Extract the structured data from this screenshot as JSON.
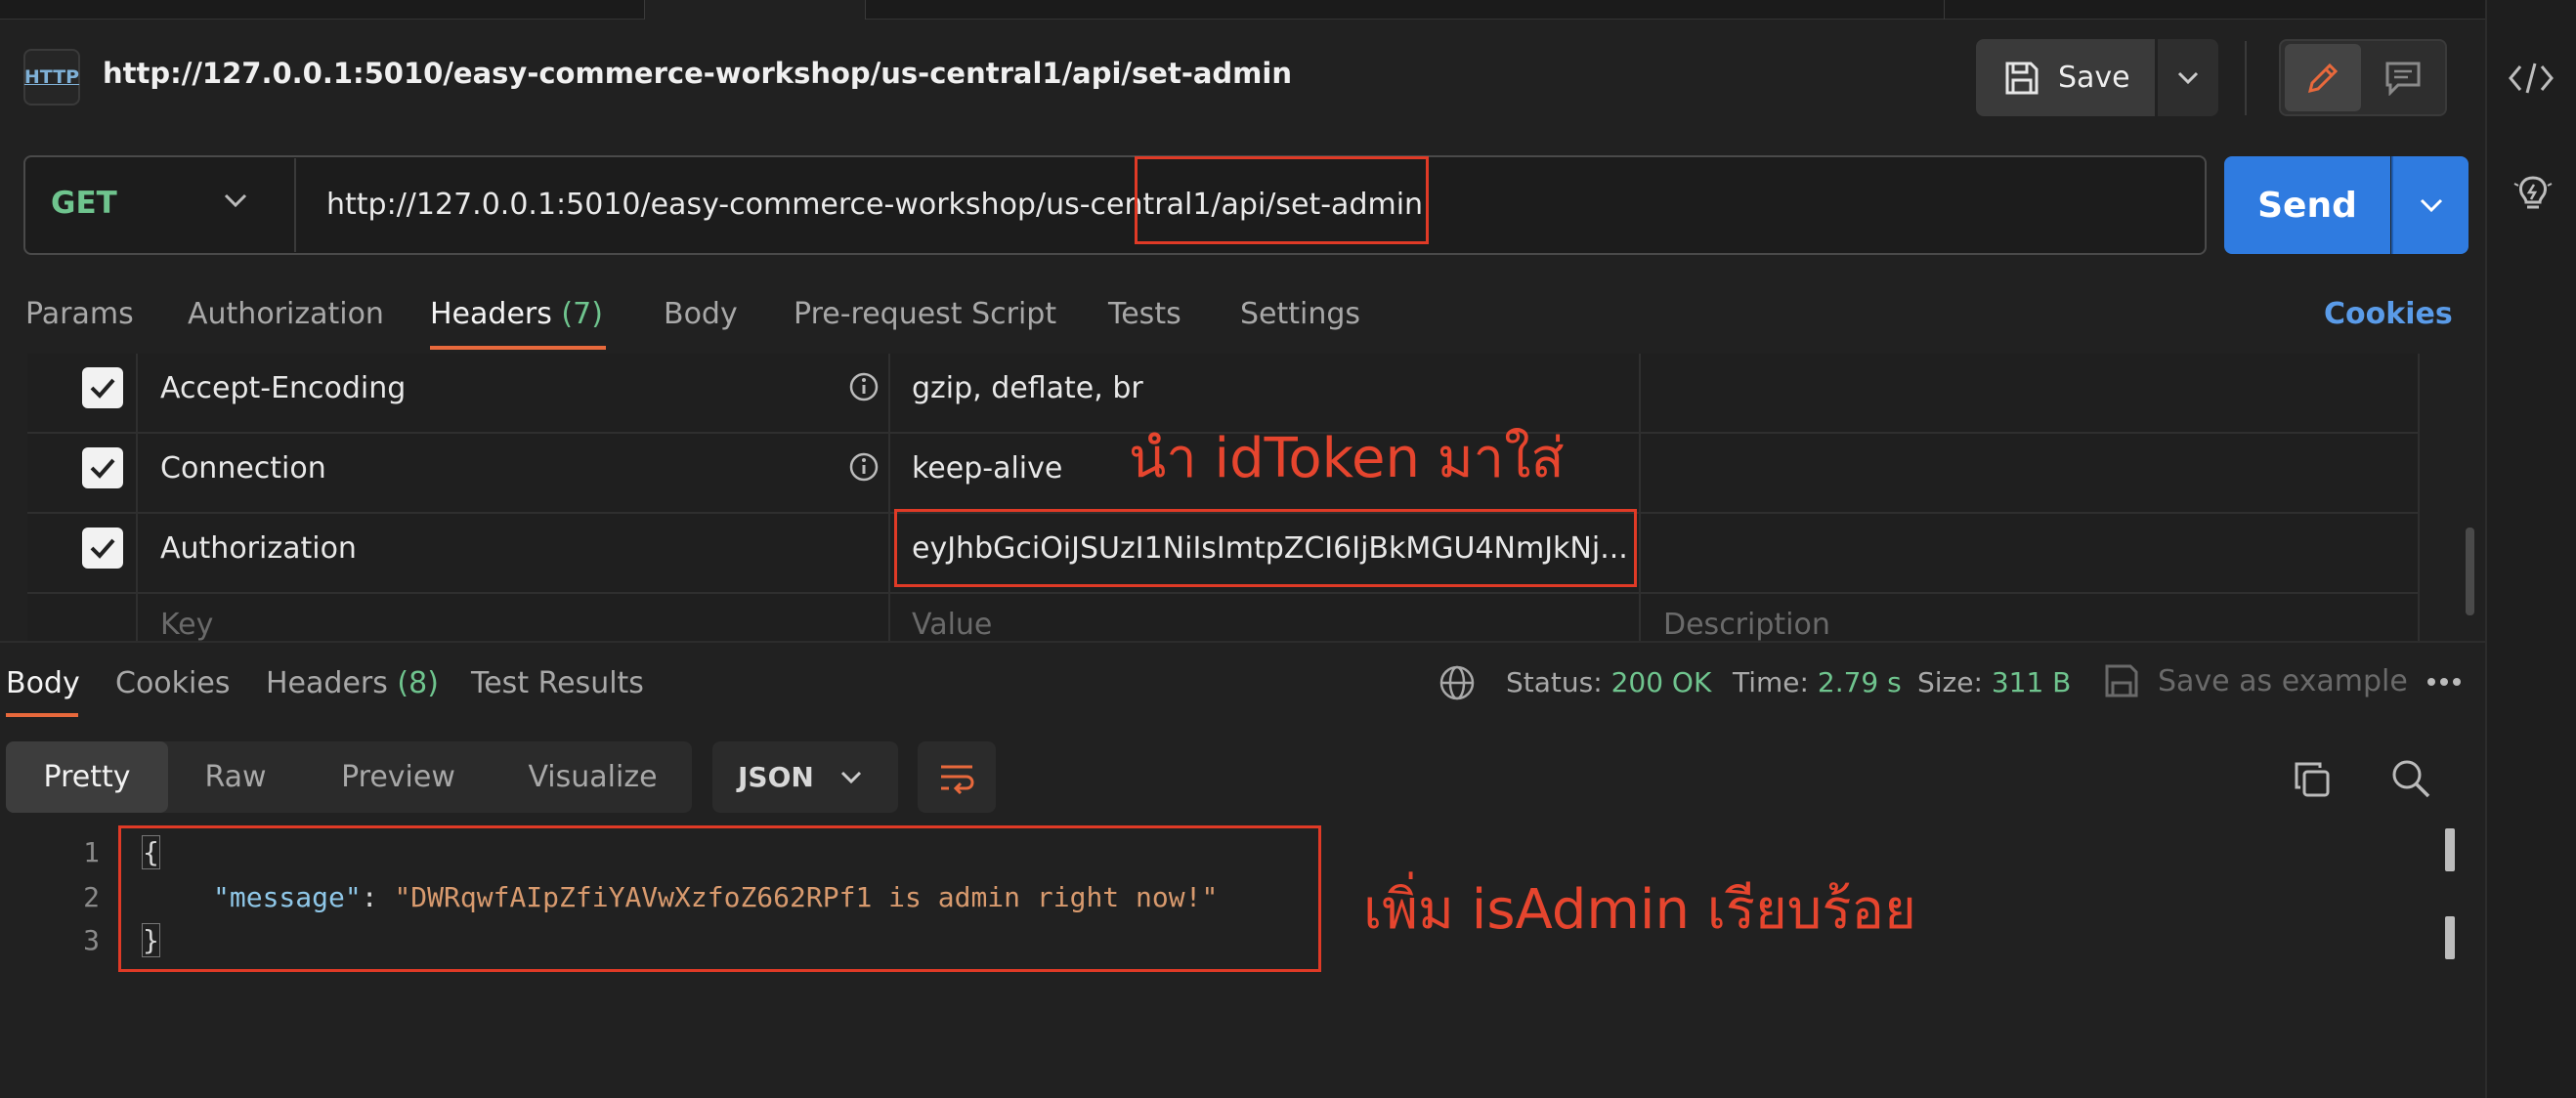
{
  "request": {
    "icon_label": "HTTP",
    "title": "http://127.0.0.1:5010/easy-commerce-workshop/us-central1/api/set-admin",
    "save_label": "Save",
    "method": "GET",
    "url": "http://127.0.0.1:5010/easy-commerce-workshop/us-central1/api/set-admin",
    "send_label": "Send"
  },
  "tabs": [
    {
      "label": "Params"
    },
    {
      "label": "Authorization"
    },
    {
      "label": "Headers",
      "count": "(7)"
    },
    {
      "label": "Body"
    },
    {
      "label": "Pre-request Script"
    },
    {
      "label": "Tests"
    },
    {
      "label": "Settings"
    }
  ],
  "cookies_link": "Cookies",
  "headers": [
    {
      "key": "Accept-Encoding",
      "value": "gzip, deflate, br",
      "checked": true
    },
    {
      "key": "Connection",
      "value": "keep-alive",
      "checked": true
    },
    {
      "key": "Authorization",
      "value": "eyJhbGciOiJSUzI1NiIsImtpZCI6IjBkMGU4NmJkNj...",
      "checked": true
    }
  ],
  "headers_placeholder": {
    "key": "Key",
    "value": "Value",
    "description": "Description"
  },
  "annotations": {
    "token_note": "นำ idToken มาใส่",
    "admin_note": "เพิ่ม isAdmin เรียบร้อย"
  },
  "response": {
    "tabs": [
      {
        "label": "Body"
      },
      {
        "label": "Cookies"
      },
      {
        "label": "Headers",
        "count": "(8)"
      },
      {
        "label": "Test Results"
      }
    ],
    "status_label": "Status:",
    "status_value": "200 OK",
    "time_label": "Time:",
    "time_value": "2.79 s",
    "size_label": "Size:",
    "size_value": "311 B",
    "save_example": "Save as example",
    "views": [
      "Pretty",
      "Raw",
      "Preview",
      "Visualize"
    ],
    "format": "JSON",
    "lines": [
      "1",
      "2",
      "3"
    ],
    "open_brace": "{",
    "close_brace": "}",
    "json_key": "\"message\"",
    "json_colon": ": ",
    "json_value": "\"DWRqwfAIpZfiYAVwXzfoZ662RPf1 is admin right now!\""
  },
  "colors": {
    "accent": "#e8693c",
    "send": "#2f7be0",
    "green": "#6fc48e",
    "annotation": "#e6452e"
  }
}
